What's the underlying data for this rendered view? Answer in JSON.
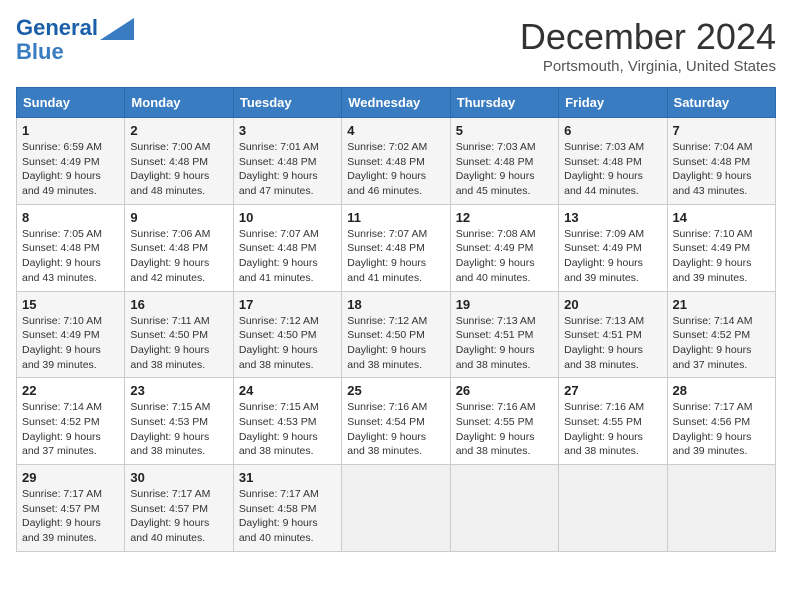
{
  "header": {
    "logo_line1": "General",
    "logo_line2": "Blue",
    "month": "December 2024",
    "location": "Portsmouth, Virginia, United States"
  },
  "weekdays": [
    "Sunday",
    "Monday",
    "Tuesday",
    "Wednesday",
    "Thursday",
    "Friday",
    "Saturday"
  ],
  "weeks": [
    [
      {
        "day": "1",
        "sunrise": "Sunrise: 6:59 AM",
        "sunset": "Sunset: 4:49 PM",
        "daylight": "Daylight: 9 hours and 49 minutes."
      },
      {
        "day": "2",
        "sunrise": "Sunrise: 7:00 AM",
        "sunset": "Sunset: 4:48 PM",
        "daylight": "Daylight: 9 hours and 48 minutes."
      },
      {
        "day": "3",
        "sunrise": "Sunrise: 7:01 AM",
        "sunset": "Sunset: 4:48 PM",
        "daylight": "Daylight: 9 hours and 47 minutes."
      },
      {
        "day": "4",
        "sunrise": "Sunrise: 7:02 AM",
        "sunset": "Sunset: 4:48 PM",
        "daylight": "Daylight: 9 hours and 46 minutes."
      },
      {
        "day": "5",
        "sunrise": "Sunrise: 7:03 AM",
        "sunset": "Sunset: 4:48 PM",
        "daylight": "Daylight: 9 hours and 45 minutes."
      },
      {
        "day": "6",
        "sunrise": "Sunrise: 7:03 AM",
        "sunset": "Sunset: 4:48 PM",
        "daylight": "Daylight: 9 hours and 44 minutes."
      },
      {
        "day": "7",
        "sunrise": "Sunrise: 7:04 AM",
        "sunset": "Sunset: 4:48 PM",
        "daylight": "Daylight: 9 hours and 43 minutes."
      }
    ],
    [
      {
        "day": "8",
        "sunrise": "Sunrise: 7:05 AM",
        "sunset": "Sunset: 4:48 PM",
        "daylight": "Daylight: 9 hours and 43 minutes."
      },
      {
        "day": "9",
        "sunrise": "Sunrise: 7:06 AM",
        "sunset": "Sunset: 4:48 PM",
        "daylight": "Daylight: 9 hours and 42 minutes."
      },
      {
        "day": "10",
        "sunrise": "Sunrise: 7:07 AM",
        "sunset": "Sunset: 4:48 PM",
        "daylight": "Daylight: 9 hours and 41 minutes."
      },
      {
        "day": "11",
        "sunrise": "Sunrise: 7:07 AM",
        "sunset": "Sunset: 4:48 PM",
        "daylight": "Daylight: 9 hours and 41 minutes."
      },
      {
        "day": "12",
        "sunrise": "Sunrise: 7:08 AM",
        "sunset": "Sunset: 4:49 PM",
        "daylight": "Daylight: 9 hours and 40 minutes."
      },
      {
        "day": "13",
        "sunrise": "Sunrise: 7:09 AM",
        "sunset": "Sunset: 4:49 PM",
        "daylight": "Daylight: 9 hours and 39 minutes."
      },
      {
        "day": "14",
        "sunrise": "Sunrise: 7:10 AM",
        "sunset": "Sunset: 4:49 PM",
        "daylight": "Daylight: 9 hours and 39 minutes."
      }
    ],
    [
      {
        "day": "15",
        "sunrise": "Sunrise: 7:10 AM",
        "sunset": "Sunset: 4:49 PM",
        "daylight": "Daylight: 9 hours and 39 minutes."
      },
      {
        "day": "16",
        "sunrise": "Sunrise: 7:11 AM",
        "sunset": "Sunset: 4:50 PM",
        "daylight": "Daylight: 9 hours and 38 minutes."
      },
      {
        "day": "17",
        "sunrise": "Sunrise: 7:12 AM",
        "sunset": "Sunset: 4:50 PM",
        "daylight": "Daylight: 9 hours and 38 minutes."
      },
      {
        "day": "18",
        "sunrise": "Sunrise: 7:12 AM",
        "sunset": "Sunset: 4:50 PM",
        "daylight": "Daylight: 9 hours and 38 minutes."
      },
      {
        "day": "19",
        "sunrise": "Sunrise: 7:13 AM",
        "sunset": "Sunset: 4:51 PM",
        "daylight": "Daylight: 9 hours and 38 minutes."
      },
      {
        "day": "20",
        "sunrise": "Sunrise: 7:13 AM",
        "sunset": "Sunset: 4:51 PM",
        "daylight": "Daylight: 9 hours and 38 minutes."
      },
      {
        "day": "21",
        "sunrise": "Sunrise: 7:14 AM",
        "sunset": "Sunset: 4:52 PM",
        "daylight": "Daylight: 9 hours and 37 minutes."
      }
    ],
    [
      {
        "day": "22",
        "sunrise": "Sunrise: 7:14 AM",
        "sunset": "Sunset: 4:52 PM",
        "daylight": "Daylight: 9 hours and 37 minutes."
      },
      {
        "day": "23",
        "sunrise": "Sunrise: 7:15 AM",
        "sunset": "Sunset: 4:53 PM",
        "daylight": "Daylight: 9 hours and 38 minutes."
      },
      {
        "day": "24",
        "sunrise": "Sunrise: 7:15 AM",
        "sunset": "Sunset: 4:53 PM",
        "daylight": "Daylight: 9 hours and 38 minutes."
      },
      {
        "day": "25",
        "sunrise": "Sunrise: 7:16 AM",
        "sunset": "Sunset: 4:54 PM",
        "daylight": "Daylight: 9 hours and 38 minutes."
      },
      {
        "day": "26",
        "sunrise": "Sunrise: 7:16 AM",
        "sunset": "Sunset: 4:55 PM",
        "daylight": "Daylight: 9 hours and 38 minutes."
      },
      {
        "day": "27",
        "sunrise": "Sunrise: 7:16 AM",
        "sunset": "Sunset: 4:55 PM",
        "daylight": "Daylight: 9 hours and 38 minutes."
      },
      {
        "day": "28",
        "sunrise": "Sunrise: 7:17 AM",
        "sunset": "Sunset: 4:56 PM",
        "daylight": "Daylight: 9 hours and 39 minutes."
      }
    ],
    [
      {
        "day": "29",
        "sunrise": "Sunrise: 7:17 AM",
        "sunset": "Sunset: 4:57 PM",
        "daylight": "Daylight: 9 hours and 39 minutes."
      },
      {
        "day": "30",
        "sunrise": "Sunrise: 7:17 AM",
        "sunset": "Sunset: 4:57 PM",
        "daylight": "Daylight: 9 hours and 40 minutes."
      },
      {
        "day": "31",
        "sunrise": "Sunrise: 7:17 AM",
        "sunset": "Sunset: 4:58 PM",
        "daylight": "Daylight: 9 hours and 40 minutes."
      },
      null,
      null,
      null,
      null
    ]
  ]
}
